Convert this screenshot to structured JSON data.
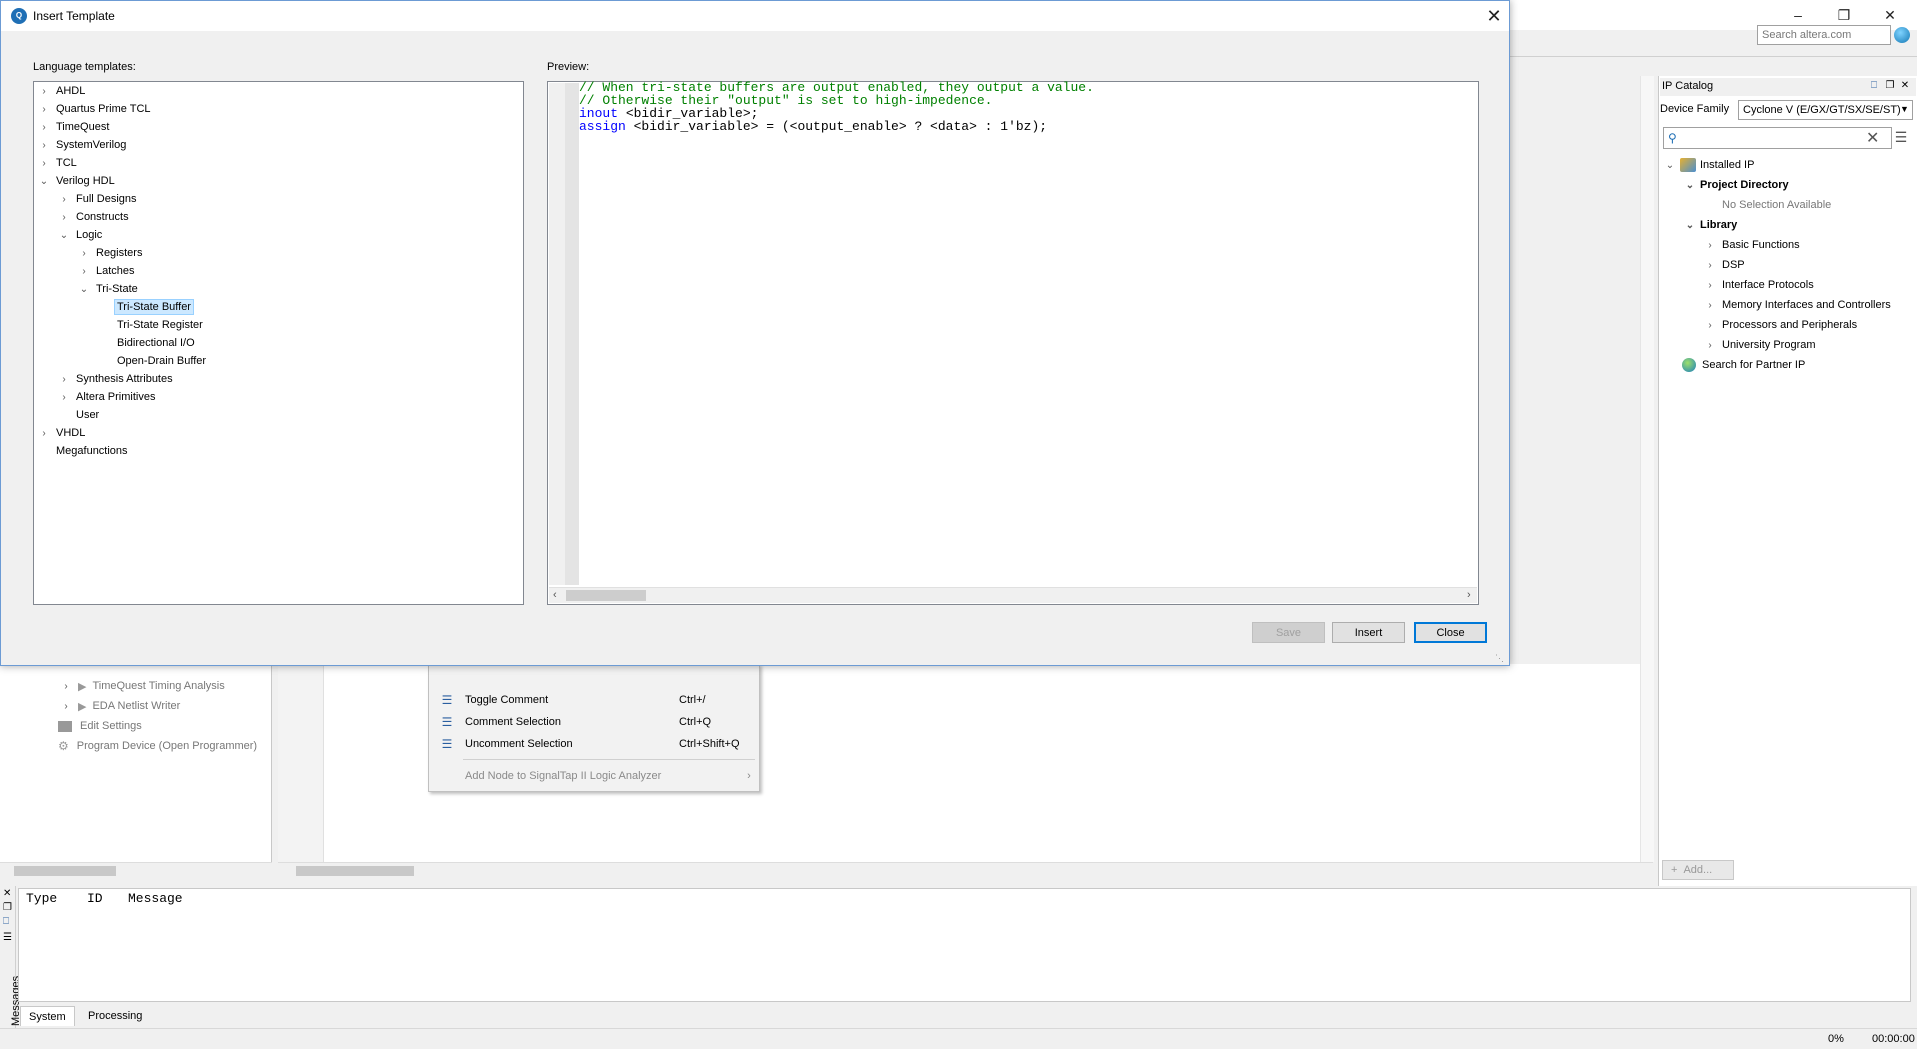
{
  "main_window": {
    "search_placeholder": "Search altera.com",
    "minimize_icon": "minimize-icon",
    "restore_icon": "restore-icon",
    "close_icon": "close-icon"
  },
  "ip_catalog": {
    "title": "IP Catalog",
    "device_family_label": "Device Family",
    "device_family_value": "Cyclone V (E/GX/GT/SX/SE/ST)",
    "installed_ip": "Installed IP",
    "project_directory": "Project Directory",
    "no_selection": "No Selection Available",
    "library": "Library",
    "library_items": [
      "Basic Functions",
      "DSP",
      "Interface Protocols",
      "Memory Interfaces and Controllers",
      "Processors and Peripherals",
      "University Program"
    ],
    "partner_ip": "Search for Partner IP",
    "add_label": "Add..."
  },
  "tasks": {
    "items": [
      "TimeQuest Timing Analysis",
      "EDA Netlist Writer",
      "Edit Settings",
      "Program Device (Open Programmer)"
    ]
  },
  "context_menu": {
    "items": [
      {
        "label": "Toggle Comment",
        "shortcut": "Ctrl+/"
      },
      {
        "label": "Comment Selection",
        "shortcut": "Ctrl+Q"
      },
      {
        "label": "Uncomment Selection",
        "shortcut": "Ctrl+Shift+Q"
      }
    ],
    "signaltap": "Add Node to SignalTap II Logic Analyzer"
  },
  "messages": {
    "col_type": "Type",
    "col_id": "ID",
    "col_message": "Message",
    "side_label": "Messages",
    "tabs": [
      "System",
      "Processing"
    ]
  },
  "status": {
    "progress": "0%",
    "time": "00:00:00"
  },
  "dialog": {
    "title": "Insert Template",
    "language_label": "Language templates:",
    "preview_label": "Preview:",
    "tree": {
      "ahdl": "AHDL",
      "quartus_tcl": "Quartus Prime TCL",
      "timequest": "TimeQuest",
      "systemverilog": "SystemVerilog",
      "tcl": "TCL",
      "verilog": "Verilog HDL",
      "full_designs": "Full Designs",
      "constructs": "Constructs",
      "logic": "Logic",
      "registers": "Registers",
      "latches": "Latches",
      "tristate": "Tri-State",
      "tristate_buffer": "Tri-State Buffer",
      "tristate_register": "Tri-State Register",
      "bidirectional_io": "Bidirectional I/O",
      "open_drain": "Open-Drain Buffer",
      "synthesis_attributes": "Synthesis Attributes",
      "altera_primitives": "Altera Primitives",
      "user": "User",
      "vhdl": "VHDL",
      "megafunctions": "Megafunctions"
    },
    "code": {
      "line1": "// When tri-state buffers are output enabled, they output a value.",
      "line2": "// Otherwise their \"output\" is set to high-impedence.",
      "line3_kw": "inout",
      "line3_rest": " <bidir_variable>;",
      "line4_kw": "assign",
      "line4_rest": " <bidir_variable> = (<output_enable> ? <data> : 1'bz);"
    },
    "buttons": {
      "save": "Save",
      "insert": "Insert",
      "close": "Close"
    }
  }
}
